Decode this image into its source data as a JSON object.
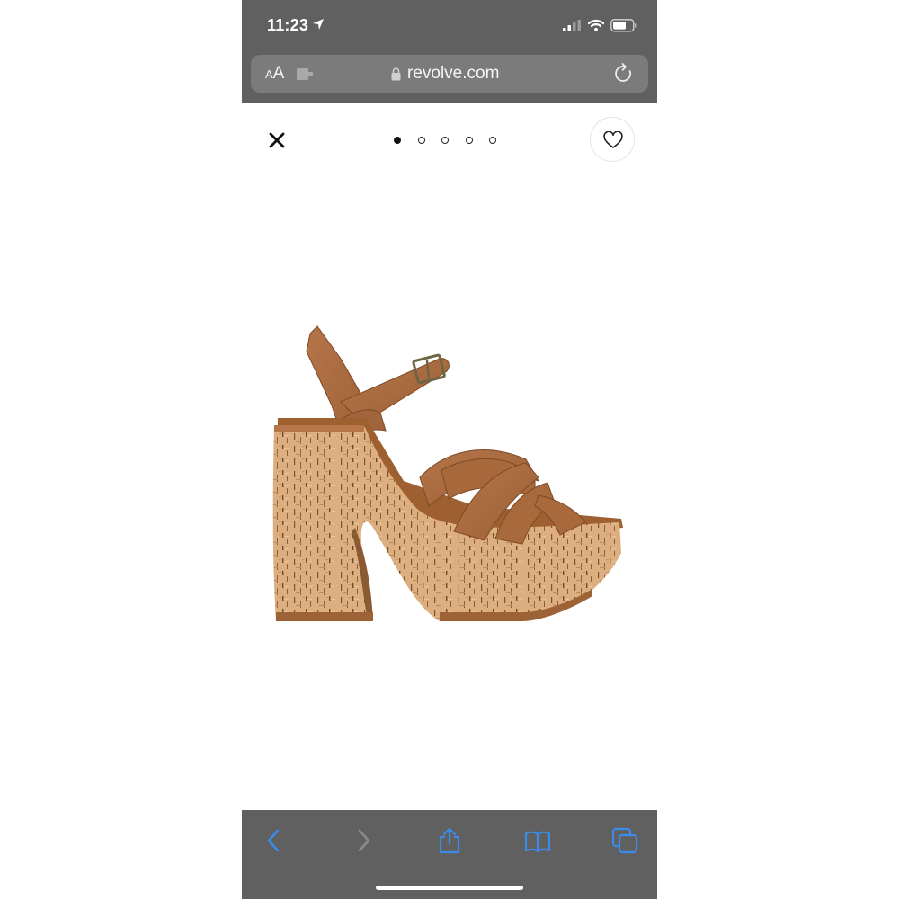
{
  "status_bar": {
    "time": "11:23",
    "icons": [
      "location-arrow-icon",
      "cellular-signal-icon",
      "wifi-icon",
      "battery-icon"
    ]
  },
  "address_bar": {
    "text_size_small": "A",
    "text_size_big": "A",
    "url": "revolve.com",
    "icons": [
      "extension-icon",
      "lock-icon",
      "reload-icon"
    ]
  },
  "product_header": {
    "icons": [
      "close-icon",
      "heart-icon"
    ],
    "carousel": {
      "total_slides": 5,
      "active_index": 0
    }
  },
  "product_image": {
    "subject": "tan suede strappy platform sandal with cork platform and flared cork heel"
  },
  "bottom_toolbar": {
    "buttons": [
      "back-icon",
      "forward-icon",
      "share-icon",
      "bookmarks-icon",
      "tabs-icon"
    ],
    "active_color": "#3b8bea",
    "disabled_color": "#8a8a8a"
  },
  "colors": {
    "chrome_bg": "#606060",
    "address_bar_bg": "#7b7b7b",
    "suede": "#a86a3c",
    "cork": "#d9ab7c"
  }
}
